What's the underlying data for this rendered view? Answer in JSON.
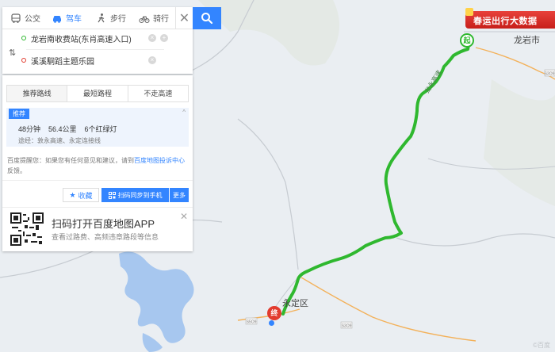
{
  "modes": [
    {
      "label": "公交",
      "icon": "bus-icon"
    },
    {
      "label": "驾车",
      "icon": "car-icon"
    },
    {
      "label": "步行",
      "icon": "walk-icon"
    },
    {
      "label": "骑行",
      "icon": "bike-icon"
    }
  ],
  "active_mode": "驾车",
  "close_symbol": "✕",
  "origin": "龙岩南收费站(东肖高速入口)",
  "destination": "溪溪駉蹈主题乐园",
  "swap_symbol": "⇅",
  "result_tabs": [
    "推荐路线",
    "最短路程",
    "不走高速"
  ],
  "route": {
    "badge": "推荐",
    "duration": "48分钟",
    "distance": "56.4公里",
    "lights": "6个红绿灯",
    "via": "途经：敦永高速、永定连接线"
  },
  "tip": {
    "before": "百度提醒您：如果您有任何意见和建议，请到",
    "link": "百度地图投诉中心",
    "after": "反馈。"
  },
  "buttons": {
    "favorite": "收藏",
    "sync": "扫码同步到手机",
    "more": "更多"
  },
  "promo": {
    "title": "扫码打开百度地图APP",
    "subtitle": "查看过路费、高频违章路段等信息"
  },
  "banner": "春运出行大数据",
  "map": {
    "city_label": "龙岩市",
    "district_label": "永定区",
    "start_marker": "起",
    "end_marker": "终",
    "highway_label": "龙永高速",
    "road_shields": [
      "S5O9",
      "S3O9",
      "S3O9"
    ],
    "watermark": "©百度"
  },
  "colors": {
    "accent": "#3385ff",
    "route": "#2fb82f",
    "water": "#a7c7ef",
    "banner": "#d42b25"
  }
}
